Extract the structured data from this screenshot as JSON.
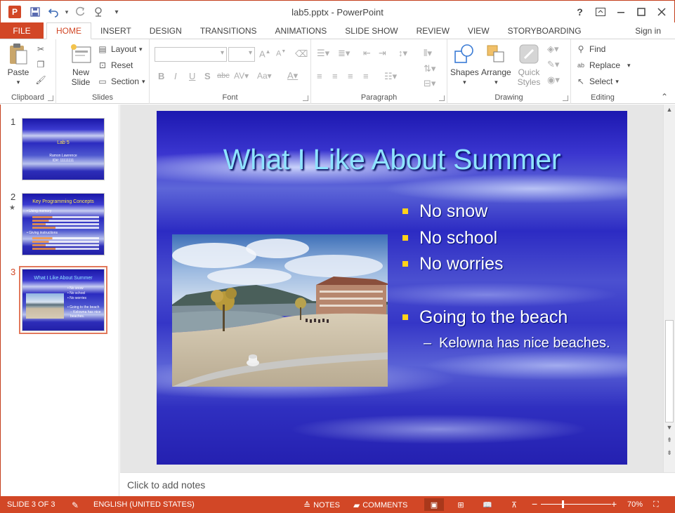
{
  "window": {
    "title": "lab5.pptx - PowerPoint",
    "app_icon": "P"
  },
  "qat": {
    "icons": [
      "save-icon",
      "undo-icon",
      "redo-icon",
      "presenter-icon",
      "customize-icon"
    ]
  },
  "tabs": [
    {
      "label": "FILE"
    },
    {
      "label": "HOME"
    },
    {
      "label": "INSERT"
    },
    {
      "label": "DESIGN"
    },
    {
      "label": "TRANSITIONS"
    },
    {
      "label": "ANIMATIONS"
    },
    {
      "label": "SLIDE SHOW"
    },
    {
      "label": "REVIEW"
    },
    {
      "label": "VIEW"
    },
    {
      "label": "STORYBOARDING"
    }
  ],
  "sign_in": "Sign in",
  "ribbon": {
    "clipboard": {
      "label": "Clipboard",
      "paste": "Paste"
    },
    "slides": {
      "label": "Slides",
      "new_slide": "New Slide",
      "layout": "Layout",
      "reset": "Reset",
      "section": "Section"
    },
    "font": {
      "label": "Font"
    },
    "paragraph": {
      "label": "Paragraph"
    },
    "drawing": {
      "label": "Drawing",
      "shapes": "Shapes",
      "arrange": "Arrange",
      "quick_styles": "Quick Styles"
    },
    "editing": {
      "label": "Editing",
      "find": "Find",
      "replace": "Replace",
      "select": "Select"
    }
  },
  "thumbnails": [
    {
      "num": "1",
      "title": "Lab 5",
      "lines": [
        "Ramon Lawrence",
        "ID#: 11111111"
      ]
    },
    {
      "num": "2",
      "title": "Key Programming Concepts",
      "lines": [
        "• Using memory",
        "• Giving instructions"
      ]
    },
    {
      "num": "3",
      "title": "What I Like About Summer",
      "lines": [
        "• No snow",
        "• No school",
        "• No worries",
        "• Going to the beach",
        "– Kelowna has nice beaches."
      ]
    }
  ],
  "slide": {
    "title": "What I Like About Summer",
    "bullets": [
      "No snow",
      "No school",
      "No worries",
      "Going to the beach"
    ],
    "sub_bullet": "Kelowna has nice beaches."
  },
  "notes_placeholder": "Click to add notes",
  "status": {
    "slide_counter": "SLIDE 3 OF 3",
    "language": "ENGLISH (UNITED STATES)",
    "notes": "NOTES",
    "comments": "COMMENTS",
    "zoom": "70%",
    "zoom_level": 0.7
  },
  "colors": {
    "accent": "#d24726",
    "title_text": "#8fe3ff",
    "bullet_marker": "#ffd21a"
  }
}
